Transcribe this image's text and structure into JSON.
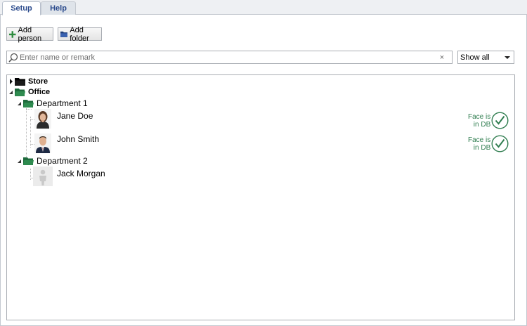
{
  "tabs": [
    {
      "label": "Setup",
      "active": true
    },
    {
      "label": "Help",
      "active": false
    }
  ],
  "toolbar": {
    "add_person_label": "Add person",
    "add_folder_label": "Add folder"
  },
  "search": {
    "placeholder": "Enter name or remark",
    "value": "",
    "clear_glyph": "×"
  },
  "filter": {
    "selected": "Show all"
  },
  "tree": {
    "folders": [
      {
        "label": "Store",
        "expanded": false
      },
      {
        "label": "Office",
        "expanded": true,
        "children": [
          {
            "label": "Department 1",
            "expanded": true,
            "people": [
              {
                "name": "Jane Doe",
                "status": [
                  "Face is",
                  "in DB"
                ]
              },
              {
                "name": "John Smith",
                "status": [
                  "Face is",
                  "in DB"
                ]
              }
            ]
          },
          {
            "label": "Department 2",
            "expanded": true,
            "people": [
              {
                "name": "Jack Morgan",
                "status": null
              }
            ]
          }
        ]
      }
    ]
  },
  "colors": {
    "accent_tab_text": "#2a4a8c",
    "folder_green": "#2e8b4f",
    "status_green": "#2f7d4f"
  }
}
